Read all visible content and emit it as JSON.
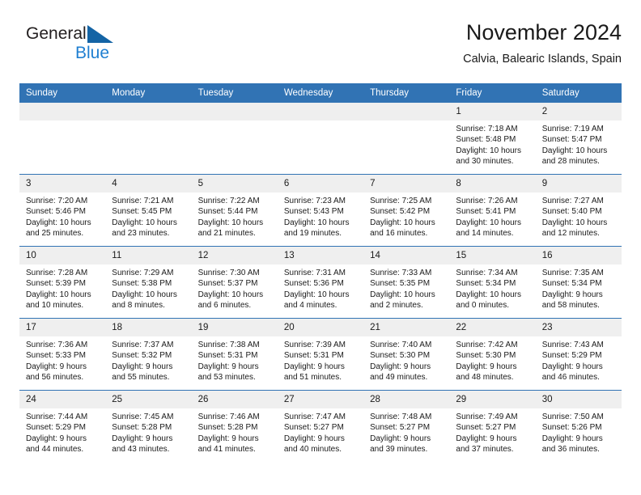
{
  "brand": {
    "name_part1": "General",
    "name_part2": "Blue",
    "triangle_color": "#1464a5",
    "blue_color": "#1f7fd1"
  },
  "header": {
    "title": "November 2024",
    "subtitle": "Calvia, Balearic Islands, Spain"
  },
  "theme": {
    "header_blue": "#3173b4",
    "daynum_gray": "#efefef",
    "text": "#1a1a1a"
  },
  "calendar": {
    "weekday_headers": [
      "Sunday",
      "Monday",
      "Tuesday",
      "Wednesday",
      "Thursday",
      "Friday",
      "Saturday"
    ],
    "weeks": [
      [
        {
          "day": "",
          "sunrise": "",
          "sunset": "",
          "daylight1": "",
          "daylight2": ""
        },
        {
          "day": "",
          "sunrise": "",
          "sunset": "",
          "daylight1": "",
          "daylight2": ""
        },
        {
          "day": "",
          "sunrise": "",
          "sunset": "",
          "daylight1": "",
          "daylight2": ""
        },
        {
          "day": "",
          "sunrise": "",
          "sunset": "",
          "daylight1": "",
          "daylight2": ""
        },
        {
          "day": "",
          "sunrise": "",
          "sunset": "",
          "daylight1": "",
          "daylight2": ""
        },
        {
          "day": "1",
          "sunrise": "Sunrise: 7:18 AM",
          "sunset": "Sunset: 5:48 PM",
          "daylight1": "Daylight: 10 hours",
          "daylight2": "and 30 minutes."
        },
        {
          "day": "2",
          "sunrise": "Sunrise: 7:19 AM",
          "sunset": "Sunset: 5:47 PM",
          "daylight1": "Daylight: 10 hours",
          "daylight2": "and 28 minutes."
        }
      ],
      [
        {
          "day": "3",
          "sunrise": "Sunrise: 7:20 AM",
          "sunset": "Sunset: 5:46 PM",
          "daylight1": "Daylight: 10 hours",
          "daylight2": "and 25 minutes."
        },
        {
          "day": "4",
          "sunrise": "Sunrise: 7:21 AM",
          "sunset": "Sunset: 5:45 PM",
          "daylight1": "Daylight: 10 hours",
          "daylight2": "and 23 minutes."
        },
        {
          "day": "5",
          "sunrise": "Sunrise: 7:22 AM",
          "sunset": "Sunset: 5:44 PM",
          "daylight1": "Daylight: 10 hours",
          "daylight2": "and 21 minutes."
        },
        {
          "day": "6",
          "sunrise": "Sunrise: 7:23 AM",
          "sunset": "Sunset: 5:43 PM",
          "daylight1": "Daylight: 10 hours",
          "daylight2": "and 19 minutes."
        },
        {
          "day": "7",
          "sunrise": "Sunrise: 7:25 AM",
          "sunset": "Sunset: 5:42 PM",
          "daylight1": "Daylight: 10 hours",
          "daylight2": "and 16 minutes."
        },
        {
          "day": "8",
          "sunrise": "Sunrise: 7:26 AM",
          "sunset": "Sunset: 5:41 PM",
          "daylight1": "Daylight: 10 hours",
          "daylight2": "and 14 minutes."
        },
        {
          "day": "9",
          "sunrise": "Sunrise: 7:27 AM",
          "sunset": "Sunset: 5:40 PM",
          "daylight1": "Daylight: 10 hours",
          "daylight2": "and 12 minutes."
        }
      ],
      [
        {
          "day": "10",
          "sunrise": "Sunrise: 7:28 AM",
          "sunset": "Sunset: 5:39 PM",
          "daylight1": "Daylight: 10 hours",
          "daylight2": "and 10 minutes."
        },
        {
          "day": "11",
          "sunrise": "Sunrise: 7:29 AM",
          "sunset": "Sunset: 5:38 PM",
          "daylight1": "Daylight: 10 hours",
          "daylight2": "and 8 minutes."
        },
        {
          "day": "12",
          "sunrise": "Sunrise: 7:30 AM",
          "sunset": "Sunset: 5:37 PM",
          "daylight1": "Daylight: 10 hours",
          "daylight2": "and 6 minutes."
        },
        {
          "day": "13",
          "sunrise": "Sunrise: 7:31 AM",
          "sunset": "Sunset: 5:36 PM",
          "daylight1": "Daylight: 10 hours",
          "daylight2": "and 4 minutes."
        },
        {
          "day": "14",
          "sunrise": "Sunrise: 7:33 AM",
          "sunset": "Sunset: 5:35 PM",
          "daylight1": "Daylight: 10 hours",
          "daylight2": "and 2 minutes."
        },
        {
          "day": "15",
          "sunrise": "Sunrise: 7:34 AM",
          "sunset": "Sunset: 5:34 PM",
          "daylight1": "Daylight: 10 hours",
          "daylight2": "and 0 minutes."
        },
        {
          "day": "16",
          "sunrise": "Sunrise: 7:35 AM",
          "sunset": "Sunset: 5:34 PM",
          "daylight1": "Daylight: 9 hours",
          "daylight2": "and 58 minutes."
        }
      ],
      [
        {
          "day": "17",
          "sunrise": "Sunrise: 7:36 AM",
          "sunset": "Sunset: 5:33 PM",
          "daylight1": "Daylight: 9 hours",
          "daylight2": "and 56 minutes."
        },
        {
          "day": "18",
          "sunrise": "Sunrise: 7:37 AM",
          "sunset": "Sunset: 5:32 PM",
          "daylight1": "Daylight: 9 hours",
          "daylight2": "and 55 minutes."
        },
        {
          "day": "19",
          "sunrise": "Sunrise: 7:38 AM",
          "sunset": "Sunset: 5:31 PM",
          "daylight1": "Daylight: 9 hours",
          "daylight2": "and 53 minutes."
        },
        {
          "day": "20",
          "sunrise": "Sunrise: 7:39 AM",
          "sunset": "Sunset: 5:31 PM",
          "daylight1": "Daylight: 9 hours",
          "daylight2": "and 51 minutes."
        },
        {
          "day": "21",
          "sunrise": "Sunrise: 7:40 AM",
          "sunset": "Sunset: 5:30 PM",
          "daylight1": "Daylight: 9 hours",
          "daylight2": "and 49 minutes."
        },
        {
          "day": "22",
          "sunrise": "Sunrise: 7:42 AM",
          "sunset": "Sunset: 5:30 PM",
          "daylight1": "Daylight: 9 hours",
          "daylight2": "and 48 minutes."
        },
        {
          "day": "23",
          "sunrise": "Sunrise: 7:43 AM",
          "sunset": "Sunset: 5:29 PM",
          "daylight1": "Daylight: 9 hours",
          "daylight2": "and 46 minutes."
        }
      ],
      [
        {
          "day": "24",
          "sunrise": "Sunrise: 7:44 AM",
          "sunset": "Sunset: 5:29 PM",
          "daylight1": "Daylight: 9 hours",
          "daylight2": "and 44 minutes."
        },
        {
          "day": "25",
          "sunrise": "Sunrise: 7:45 AM",
          "sunset": "Sunset: 5:28 PM",
          "daylight1": "Daylight: 9 hours",
          "daylight2": "and 43 minutes."
        },
        {
          "day": "26",
          "sunrise": "Sunrise: 7:46 AM",
          "sunset": "Sunset: 5:28 PM",
          "daylight1": "Daylight: 9 hours",
          "daylight2": "and 41 minutes."
        },
        {
          "day": "27",
          "sunrise": "Sunrise: 7:47 AM",
          "sunset": "Sunset: 5:27 PM",
          "daylight1": "Daylight: 9 hours",
          "daylight2": "and 40 minutes."
        },
        {
          "day": "28",
          "sunrise": "Sunrise: 7:48 AM",
          "sunset": "Sunset: 5:27 PM",
          "daylight1": "Daylight: 9 hours",
          "daylight2": "and 39 minutes."
        },
        {
          "day": "29",
          "sunrise": "Sunrise: 7:49 AM",
          "sunset": "Sunset: 5:27 PM",
          "daylight1": "Daylight: 9 hours",
          "daylight2": "and 37 minutes."
        },
        {
          "day": "30",
          "sunrise": "Sunrise: 7:50 AM",
          "sunset": "Sunset: 5:26 PM",
          "daylight1": "Daylight: 9 hours",
          "daylight2": "and 36 minutes."
        }
      ]
    ]
  }
}
